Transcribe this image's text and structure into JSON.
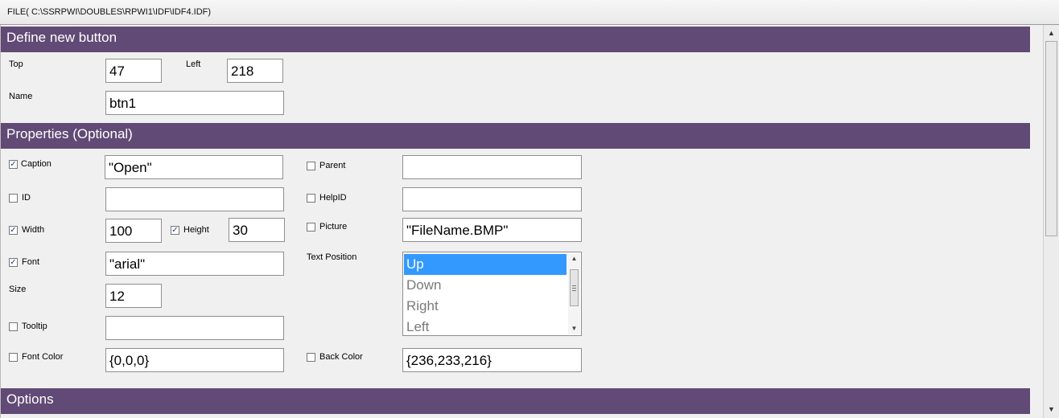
{
  "window": {
    "title": "FILE( C:\\SSRPWI\\DOUBLES\\RPWI1\\IDF\\IDF4.IDF)"
  },
  "define_section": {
    "heading": "Define new button",
    "top_label": "Top",
    "top_value": "47",
    "left_label": "Left",
    "left_value": "218",
    "name_label": "Name",
    "name_value": "btn1"
  },
  "properties_section": {
    "heading": "Properties (Optional)",
    "caption": {
      "label": "Caption",
      "checked": true,
      "value": "\"Open\""
    },
    "id": {
      "label": "ID",
      "checked": false,
      "value": ""
    },
    "width": {
      "label": "Width",
      "checked": true,
      "value": "100"
    },
    "height": {
      "label": "Height",
      "checked": true,
      "value": "30"
    },
    "font": {
      "label": "Font",
      "checked": true,
      "value": "\"arial\""
    },
    "size": {
      "label": "Size",
      "value": "12"
    },
    "tooltip": {
      "label": "Tooltip",
      "checked": false,
      "value": ""
    },
    "font_color": {
      "label": "Font Color",
      "checked": false,
      "value": "{0,0,0}"
    },
    "parent": {
      "label": "Parent",
      "checked": false,
      "value": ""
    },
    "helpid": {
      "label": "HelpID",
      "checked": false,
      "value": ""
    },
    "picture": {
      "label": "Picture",
      "checked": false,
      "value": "\"FileName.BMP\""
    },
    "text_position": {
      "label": "Text Position",
      "options": [
        "Up",
        "Down",
        "Right",
        "Left"
      ],
      "selected": "Up"
    },
    "back_color": {
      "label": "Back Color",
      "checked": false,
      "value": "{236,233,216}"
    }
  },
  "options_section": {
    "heading": "Options"
  },
  "colors": {
    "section_header_bg": "#614a75",
    "selection_bg": "#3399ff"
  },
  "icons": {
    "check": "checkmark-icon",
    "scroll_up": "arrow-up-icon",
    "scroll_down": "arrow-down-icon"
  }
}
